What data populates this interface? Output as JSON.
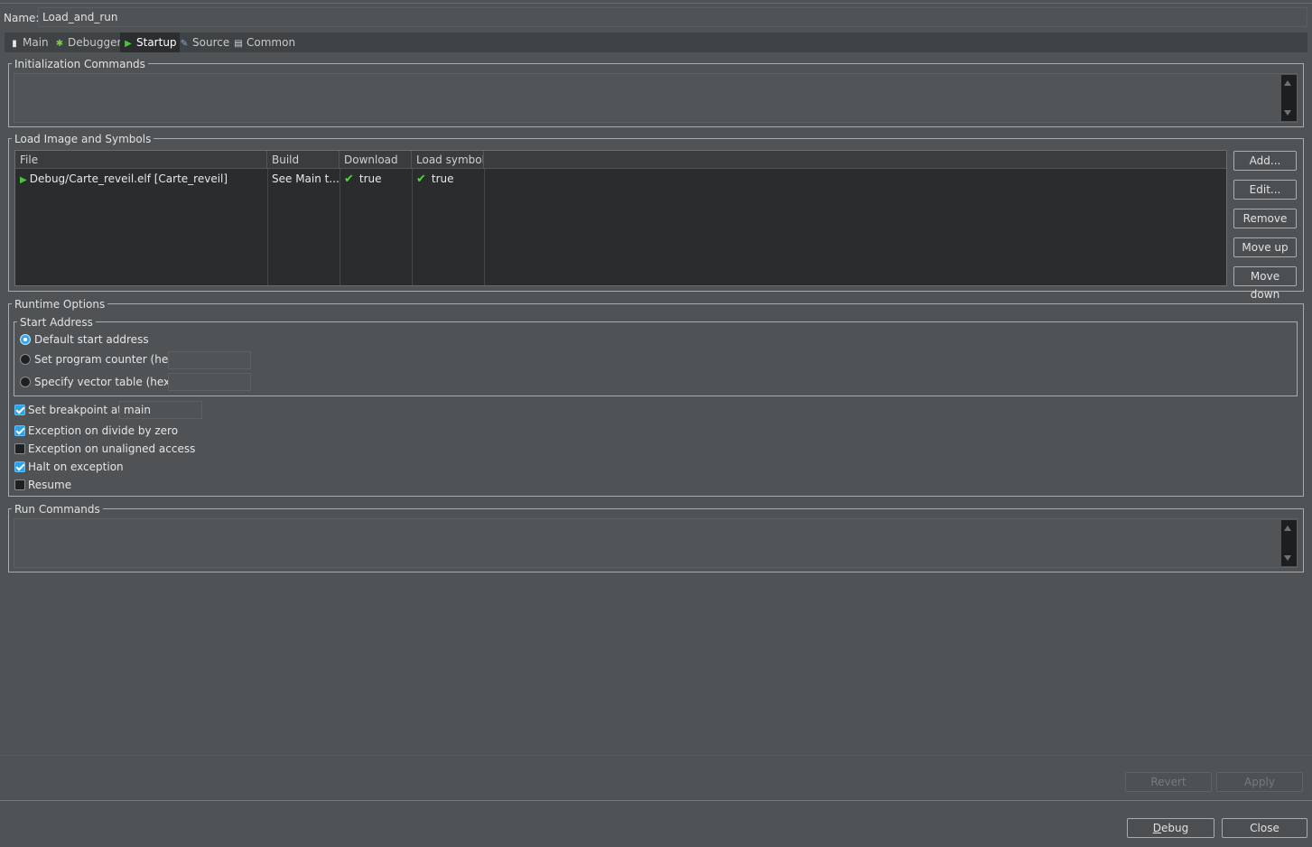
{
  "name": {
    "label": "Name:",
    "value": "Load_and_run"
  },
  "tabs": [
    {
      "label": "Main",
      "icon": "document-icon",
      "active": false
    },
    {
      "label": "Debugger",
      "icon": "bug-icon",
      "active": false
    },
    {
      "label": "Startup",
      "icon": "play-icon",
      "active": true
    },
    {
      "label": "Source",
      "icon": "source-icon",
      "active": false
    },
    {
      "label": "Common",
      "icon": "window-icon",
      "active": false
    }
  ],
  "init_commands": {
    "title": "Initialization Commands",
    "value": ""
  },
  "load_image": {
    "title": "Load Image and Symbols",
    "columns": [
      "File",
      "Build",
      "Download",
      "Load symbols"
    ],
    "rows": [
      {
        "file": "Debug/Carte_reveil.elf [Carte_reveil]",
        "build": "See Main t...",
        "download": "true",
        "load_symbols": "true"
      }
    ],
    "buttons": {
      "add": "Add...",
      "edit": "Edit...",
      "remove": "Remove",
      "move_up": "Move up",
      "move_down": "Move down"
    }
  },
  "runtime": {
    "title": "Runtime Options",
    "start_address": {
      "title": "Start Address",
      "default": "Default start address",
      "program_counter": "Set program counter (hex):",
      "vector_table": "Specify vector table (hex):",
      "selected": "default"
    },
    "set_breakpoint": {
      "label": "Set breakpoint at:",
      "value": "main",
      "checked": true
    },
    "divide_by_zero": {
      "label": "Exception on divide by zero",
      "checked": true
    },
    "unaligned": {
      "label": "Exception on unaligned access",
      "checked": false
    },
    "halt": {
      "label": "Halt on exception",
      "checked": true
    },
    "resume": {
      "label": "Resume",
      "checked": false
    }
  },
  "run_commands": {
    "title": "Run Commands",
    "value": ""
  },
  "footer": {
    "revert": "Revert",
    "apply": "Apply",
    "debug": "Debug",
    "close": "Close"
  },
  "colors": {
    "background": "#4f5356",
    "accent": "#2ea2e6",
    "check_green": "#4ed63e"
  }
}
